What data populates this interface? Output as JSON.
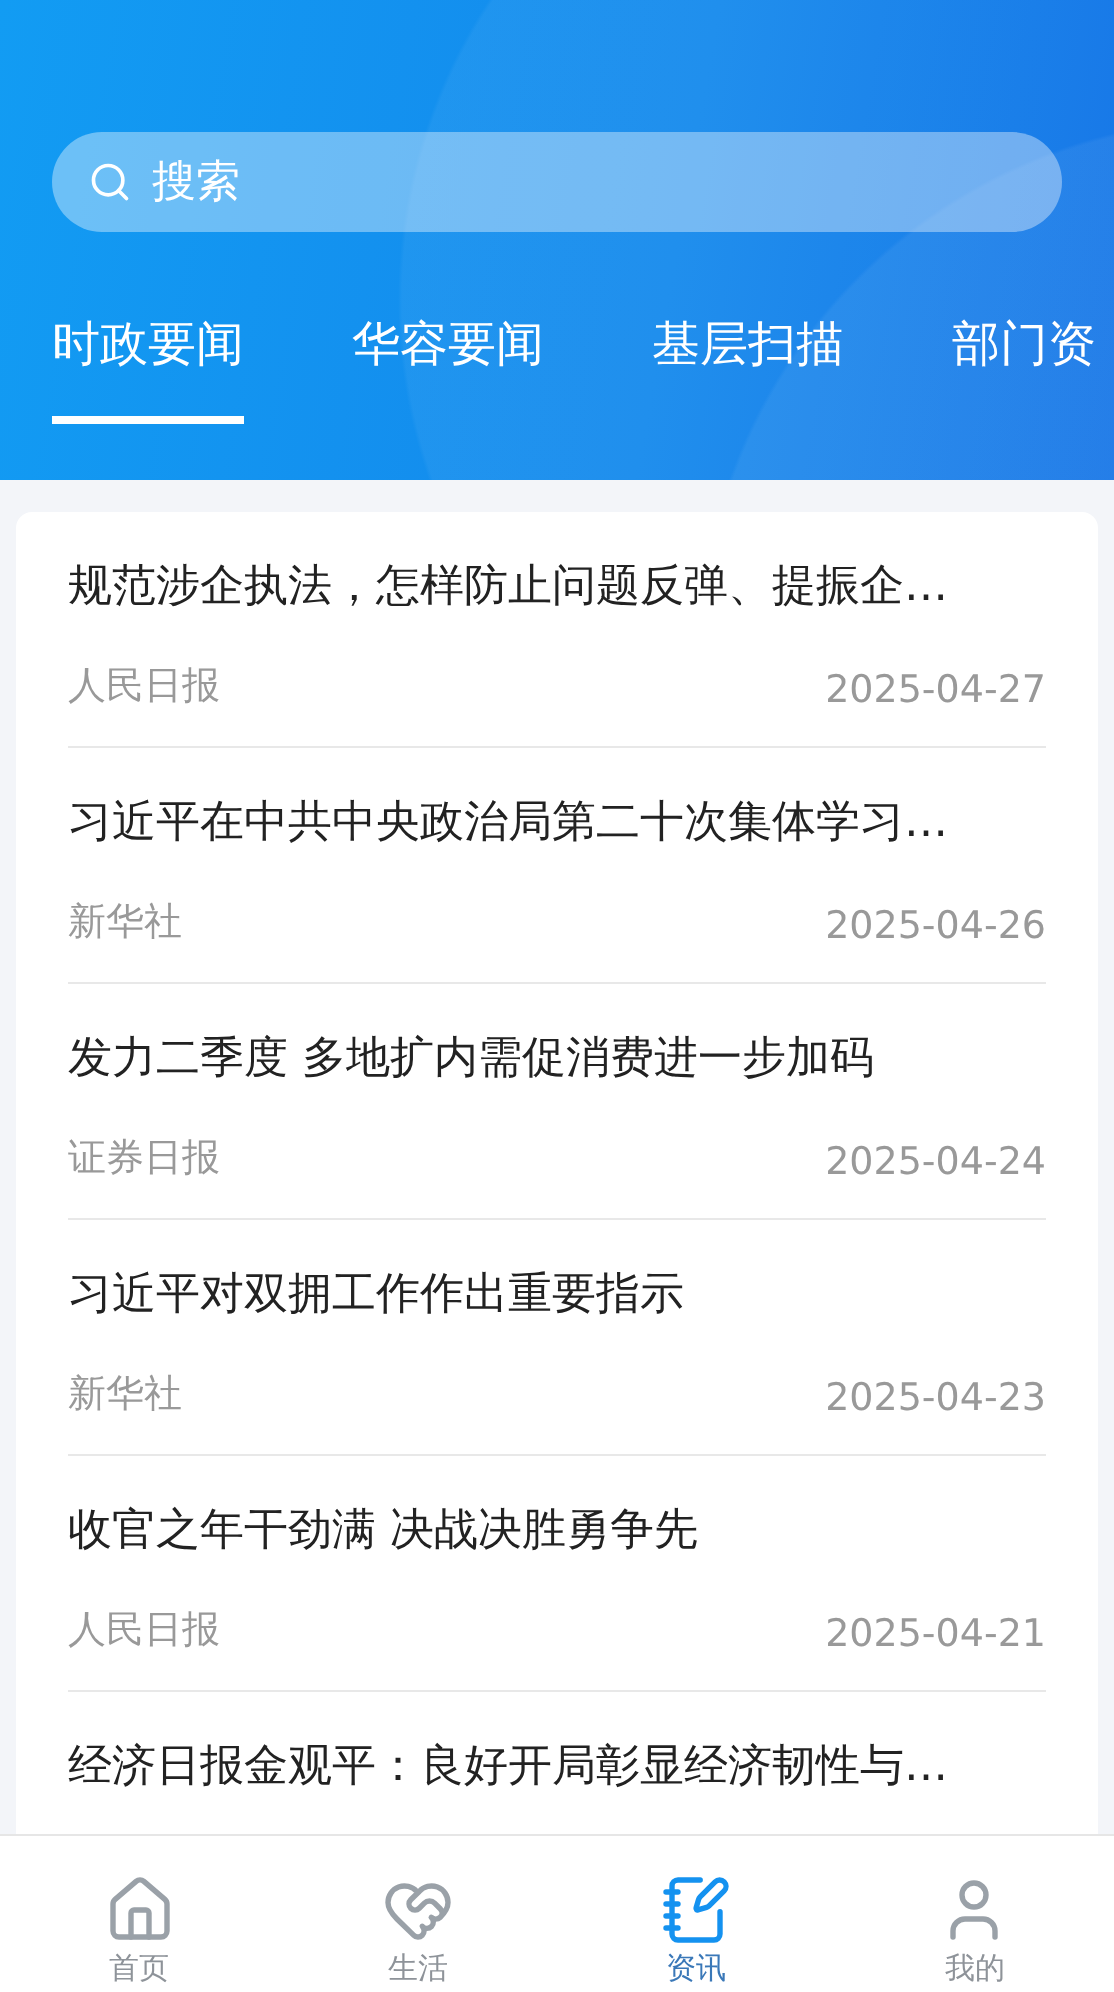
{
  "search": {
    "placeholder": "搜索"
  },
  "tabs": [
    {
      "label": "时政要闻",
      "selected": true
    },
    {
      "label": "华容要闻",
      "selected": false
    },
    {
      "label": "基层扫描",
      "selected": false
    },
    {
      "label": "部门资",
      "selected": false
    }
  ],
  "news": [
    {
      "title": "规范涉企执法，怎样防止问题反弹、提振企…",
      "source": "人民日报",
      "date": "2025-04-27"
    },
    {
      "title": "习近平在中共中央政治局第二十次集体学习…",
      "source": "新华社",
      "date": "2025-04-26"
    },
    {
      "title": "发力二季度 多地扩内需促消费进一步加码",
      "source": "证券日报",
      "date": "2025-04-24"
    },
    {
      "title": "习近平对双拥工作作出重要指示",
      "source": "新华社",
      "date": "2025-04-23"
    },
    {
      "title": "收官之年干劲满 决战决胜勇争先",
      "source": "人民日报",
      "date": "2025-04-21"
    },
    {
      "title": "经济日报金观平：良好开局彰显经济韧性与…"
    }
  ],
  "nav": [
    {
      "kind": "home",
      "label": "首页",
      "selected": false
    },
    {
      "kind": "life",
      "label": "生活",
      "selected": false
    },
    {
      "kind": "news",
      "label": "资讯",
      "selected": true
    },
    {
      "kind": "profile",
      "label": "我的",
      "selected": false
    }
  ]
}
